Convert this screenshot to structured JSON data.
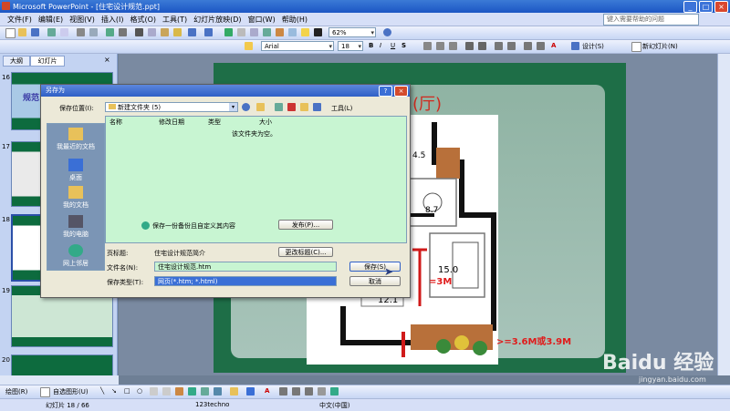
{
  "window": {
    "title": "Microsoft PowerPoint - [住宅设计规范.ppt]"
  },
  "menu": {
    "items": [
      "文件(F)",
      "编辑(E)",
      "视图(V)",
      "插入(I)",
      "格式(O)",
      "工具(T)",
      "幻灯片放映(D)",
      "窗口(W)",
      "帮助(H)"
    ],
    "help_placeholder": "键入需要帮助的问题"
  },
  "toolbar": {
    "zoom": "62%",
    "font": "Arial",
    "font_size": "18",
    "design_label": "设计(S)",
    "new_slide_label": "新幻灯片(N)"
  },
  "left_pane": {
    "tabs": [
      "大纲",
      "幻灯片"
    ],
    "slide_numbers": [
      "16",
      "17",
      "18",
      "19",
      "20"
    ],
    "thumb16_text": "规范"
  },
  "slide": {
    "title": "(厅)",
    "labels": [
      "4.5",
      "8.7",
      "15.0",
      "12.1"
    ],
    "marks": [
      "=3M",
      ">=3.6M或3.9M"
    ]
  },
  "dialog": {
    "title": "另存为",
    "save_in_label": "保存位置(I):",
    "save_in_value": "新建文件夹 (5)",
    "tools_label": "工具(L)",
    "places": [
      "我最近的文档",
      "桌面",
      "我的文档",
      "我的电脑",
      "网上邻居"
    ],
    "columns": [
      "名称",
      "修改日期",
      "类型",
      "大小"
    ],
    "empty_text": "该文件夹为空。",
    "backup_text": "保存一份备份且自定义其内容",
    "publish_label": "发布(P)...",
    "page_title_label": "页标题:",
    "page_title_value": "住宅设计规范简介",
    "change_title_label": "更改标题(C)...",
    "filename_label": "文件名(N):",
    "filename_value": "住宅设计规范.htm",
    "filetype_label": "保存类型(T):",
    "filetype_value": "网页(*.htm; *.html)",
    "save_label": "保存(S)",
    "cancel_label": "取消"
  },
  "drawbar": {
    "draw_label": "绘图(R)",
    "autoshape_label": "自选图形(U)"
  },
  "status": {
    "slide": "幻灯片 18 / 66",
    "template": "123techno",
    "language": "中文(中国)"
  },
  "watermark": {
    "brand": "Baidu 经验",
    "url": "jingyan.baidu.com"
  }
}
